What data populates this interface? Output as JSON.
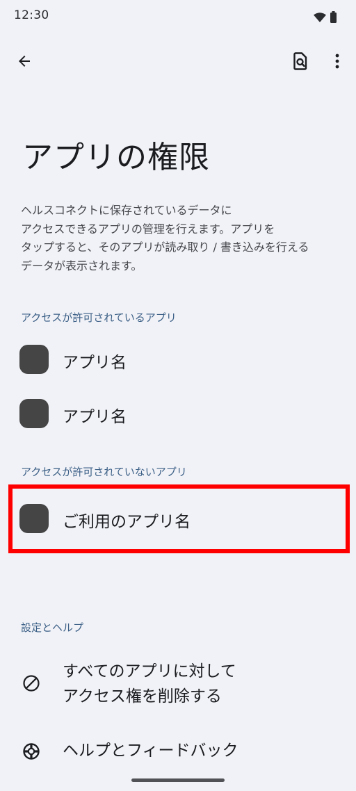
{
  "status_bar": {
    "time": "12:30",
    "icons": [
      "wifi-icon",
      "battery-icon"
    ]
  },
  "app_bar": {
    "back_icon": "arrow-back-icon",
    "actions": [
      "document-search-icon",
      "more-vert-icon"
    ]
  },
  "page": {
    "title": "アプリの権限",
    "description_lines": [
      "ヘルスコネクトに保存されているデータに",
      "アクセスできるアプリの管理を行えます。アプリを",
      "タップすると、そのアプリが読み取り / 書き込みを行える",
      "データが表示されます。"
    ]
  },
  "allowed_section": {
    "header": "アクセスが許可されているアプリ",
    "apps": [
      {
        "name": "アプリ名"
      },
      {
        "name": "アプリ名"
      }
    ]
  },
  "denied_section": {
    "header": "アクセスが許可されていないアプリ",
    "apps": [
      {
        "name": "ご利用のアプリ名"
      }
    ]
  },
  "settings_section": {
    "header": "設定とヘルプ",
    "items": [
      {
        "icon": "block-icon",
        "label_lines": [
          "すべてのアプリに対して",
          "アクセス権を削除する"
        ]
      },
      {
        "icon": "help-lifebuoy-icon",
        "label_lines": [
          "ヘルプとフィードバック"
        ]
      }
    ]
  },
  "colors": {
    "background": "#f1f2f7",
    "section_header": "#3b5f86",
    "app_icon": "#454545",
    "highlight": "#ff0000"
  }
}
